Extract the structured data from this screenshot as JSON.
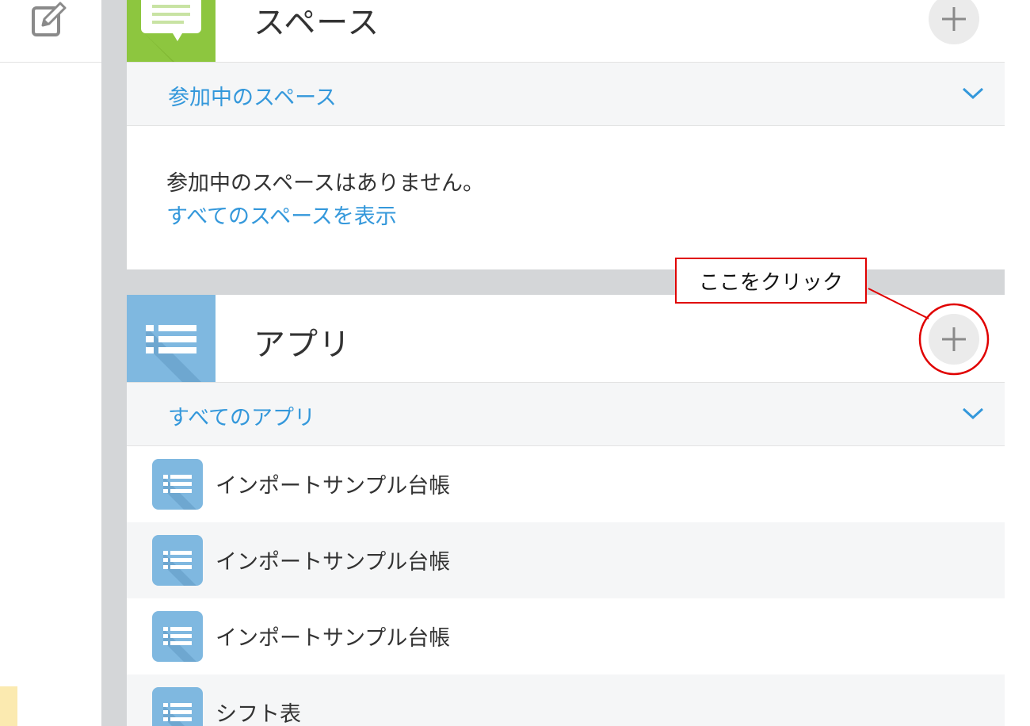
{
  "spaces": {
    "title": "スペース",
    "filter_label": "参加中のスペース",
    "empty_message": "参加中のスペースはありません。",
    "show_all_link": "すべてのスペースを表示"
  },
  "apps": {
    "title": "アプリ",
    "filter_label": "すべてのアプリ",
    "items": [
      {
        "name": "インポートサンプル台帳"
      },
      {
        "name": "インポートサンプル台帳"
      },
      {
        "name": "インポートサンプル台帳"
      },
      {
        "name": "シフト表"
      }
    ]
  },
  "annotation": {
    "callout_text": "ここをクリック",
    "color": "#e00000"
  },
  "colors": {
    "link_blue": "#3498db",
    "space_icon_green": "#8dc63f",
    "app_icon_blue": "#7fb8e0"
  },
  "icons": {
    "edit": "edit-icon",
    "space": "space-speech-bubble-icon",
    "app": "app-list-icon",
    "add": "plus-icon",
    "expand": "chevron-down-icon"
  }
}
